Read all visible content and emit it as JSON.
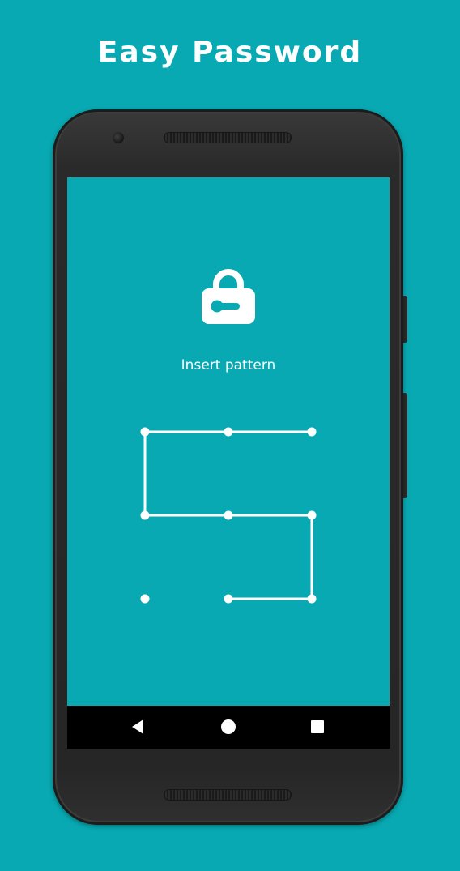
{
  "promo": {
    "title": "Easy Password"
  },
  "screen": {
    "status_text": "Insert pattern"
  },
  "pattern": {
    "grid": "3x3",
    "dots": [
      1,
      2,
      3,
      4,
      5,
      6,
      7,
      8,
      9
    ],
    "selected_sequence": [
      3,
      2,
      1,
      4,
      5,
      6,
      9,
      8
    ]
  },
  "nav": {
    "back_icon": "back-triangle-icon",
    "home_icon": "home-circle-icon",
    "recents_icon": "recents-square-icon"
  },
  "colors": {
    "background": "#08a9b2",
    "foreground": "#ffffff",
    "phone_body": "#262626",
    "navbar": "#000000"
  }
}
